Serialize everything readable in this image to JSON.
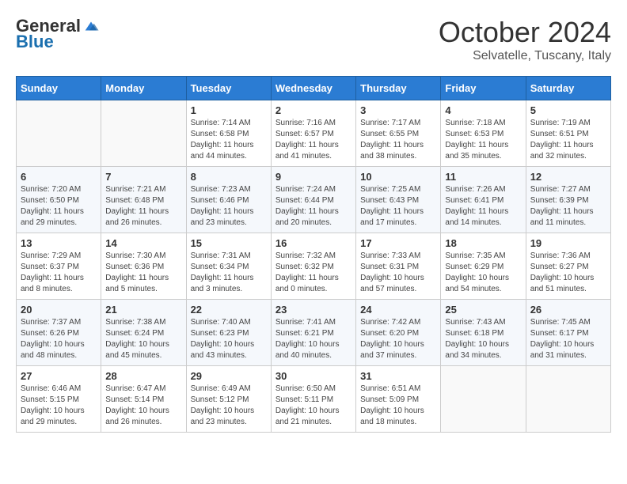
{
  "header": {
    "logo_general": "General",
    "logo_blue": "Blue",
    "month_title": "October 2024",
    "subtitle": "Selvatelle, Tuscany, Italy"
  },
  "days_of_week": [
    "Sunday",
    "Monday",
    "Tuesday",
    "Wednesday",
    "Thursday",
    "Friday",
    "Saturday"
  ],
  "weeks": [
    [
      {
        "day": "",
        "sunrise": "",
        "sunset": "",
        "daylight": ""
      },
      {
        "day": "",
        "sunrise": "",
        "sunset": "",
        "daylight": ""
      },
      {
        "day": "1",
        "sunrise": "Sunrise: 7:14 AM",
        "sunset": "Sunset: 6:58 PM",
        "daylight": "Daylight: 11 hours and 44 minutes."
      },
      {
        "day": "2",
        "sunrise": "Sunrise: 7:16 AM",
        "sunset": "Sunset: 6:57 PM",
        "daylight": "Daylight: 11 hours and 41 minutes."
      },
      {
        "day": "3",
        "sunrise": "Sunrise: 7:17 AM",
        "sunset": "Sunset: 6:55 PM",
        "daylight": "Daylight: 11 hours and 38 minutes."
      },
      {
        "day": "4",
        "sunrise": "Sunrise: 7:18 AM",
        "sunset": "Sunset: 6:53 PM",
        "daylight": "Daylight: 11 hours and 35 minutes."
      },
      {
        "day": "5",
        "sunrise": "Sunrise: 7:19 AM",
        "sunset": "Sunset: 6:51 PM",
        "daylight": "Daylight: 11 hours and 32 minutes."
      }
    ],
    [
      {
        "day": "6",
        "sunrise": "Sunrise: 7:20 AM",
        "sunset": "Sunset: 6:50 PM",
        "daylight": "Daylight: 11 hours and 29 minutes."
      },
      {
        "day": "7",
        "sunrise": "Sunrise: 7:21 AM",
        "sunset": "Sunset: 6:48 PM",
        "daylight": "Daylight: 11 hours and 26 minutes."
      },
      {
        "day": "8",
        "sunrise": "Sunrise: 7:23 AM",
        "sunset": "Sunset: 6:46 PM",
        "daylight": "Daylight: 11 hours and 23 minutes."
      },
      {
        "day": "9",
        "sunrise": "Sunrise: 7:24 AM",
        "sunset": "Sunset: 6:44 PM",
        "daylight": "Daylight: 11 hours and 20 minutes."
      },
      {
        "day": "10",
        "sunrise": "Sunrise: 7:25 AM",
        "sunset": "Sunset: 6:43 PM",
        "daylight": "Daylight: 11 hours and 17 minutes."
      },
      {
        "day": "11",
        "sunrise": "Sunrise: 7:26 AM",
        "sunset": "Sunset: 6:41 PM",
        "daylight": "Daylight: 11 hours and 14 minutes."
      },
      {
        "day": "12",
        "sunrise": "Sunrise: 7:27 AM",
        "sunset": "Sunset: 6:39 PM",
        "daylight": "Daylight: 11 hours and 11 minutes."
      }
    ],
    [
      {
        "day": "13",
        "sunrise": "Sunrise: 7:29 AM",
        "sunset": "Sunset: 6:37 PM",
        "daylight": "Daylight: 11 hours and 8 minutes."
      },
      {
        "day": "14",
        "sunrise": "Sunrise: 7:30 AM",
        "sunset": "Sunset: 6:36 PM",
        "daylight": "Daylight: 11 hours and 5 minutes."
      },
      {
        "day": "15",
        "sunrise": "Sunrise: 7:31 AM",
        "sunset": "Sunset: 6:34 PM",
        "daylight": "Daylight: 11 hours and 3 minutes."
      },
      {
        "day": "16",
        "sunrise": "Sunrise: 7:32 AM",
        "sunset": "Sunset: 6:32 PM",
        "daylight": "Daylight: 11 hours and 0 minutes."
      },
      {
        "day": "17",
        "sunrise": "Sunrise: 7:33 AM",
        "sunset": "Sunset: 6:31 PM",
        "daylight": "Daylight: 10 hours and 57 minutes."
      },
      {
        "day": "18",
        "sunrise": "Sunrise: 7:35 AM",
        "sunset": "Sunset: 6:29 PM",
        "daylight": "Daylight: 10 hours and 54 minutes."
      },
      {
        "day": "19",
        "sunrise": "Sunrise: 7:36 AM",
        "sunset": "Sunset: 6:27 PM",
        "daylight": "Daylight: 10 hours and 51 minutes."
      }
    ],
    [
      {
        "day": "20",
        "sunrise": "Sunrise: 7:37 AM",
        "sunset": "Sunset: 6:26 PM",
        "daylight": "Daylight: 10 hours and 48 minutes."
      },
      {
        "day": "21",
        "sunrise": "Sunrise: 7:38 AM",
        "sunset": "Sunset: 6:24 PM",
        "daylight": "Daylight: 10 hours and 45 minutes."
      },
      {
        "day": "22",
        "sunrise": "Sunrise: 7:40 AM",
        "sunset": "Sunset: 6:23 PM",
        "daylight": "Daylight: 10 hours and 43 minutes."
      },
      {
        "day": "23",
        "sunrise": "Sunrise: 7:41 AM",
        "sunset": "Sunset: 6:21 PM",
        "daylight": "Daylight: 10 hours and 40 minutes."
      },
      {
        "day": "24",
        "sunrise": "Sunrise: 7:42 AM",
        "sunset": "Sunset: 6:20 PM",
        "daylight": "Daylight: 10 hours and 37 minutes."
      },
      {
        "day": "25",
        "sunrise": "Sunrise: 7:43 AM",
        "sunset": "Sunset: 6:18 PM",
        "daylight": "Daylight: 10 hours and 34 minutes."
      },
      {
        "day": "26",
        "sunrise": "Sunrise: 7:45 AM",
        "sunset": "Sunset: 6:17 PM",
        "daylight": "Daylight: 10 hours and 31 minutes."
      }
    ],
    [
      {
        "day": "27",
        "sunrise": "Sunrise: 6:46 AM",
        "sunset": "Sunset: 5:15 PM",
        "daylight": "Daylight: 10 hours and 29 minutes."
      },
      {
        "day": "28",
        "sunrise": "Sunrise: 6:47 AM",
        "sunset": "Sunset: 5:14 PM",
        "daylight": "Daylight: 10 hours and 26 minutes."
      },
      {
        "day": "29",
        "sunrise": "Sunrise: 6:49 AM",
        "sunset": "Sunset: 5:12 PM",
        "daylight": "Daylight: 10 hours and 23 minutes."
      },
      {
        "day": "30",
        "sunrise": "Sunrise: 6:50 AM",
        "sunset": "Sunset: 5:11 PM",
        "daylight": "Daylight: 10 hours and 21 minutes."
      },
      {
        "day": "31",
        "sunrise": "Sunrise: 6:51 AM",
        "sunset": "Sunset: 5:09 PM",
        "daylight": "Daylight: 10 hours and 18 minutes."
      },
      {
        "day": "",
        "sunrise": "",
        "sunset": "",
        "daylight": ""
      },
      {
        "day": "",
        "sunrise": "",
        "sunset": "",
        "daylight": ""
      }
    ]
  ]
}
